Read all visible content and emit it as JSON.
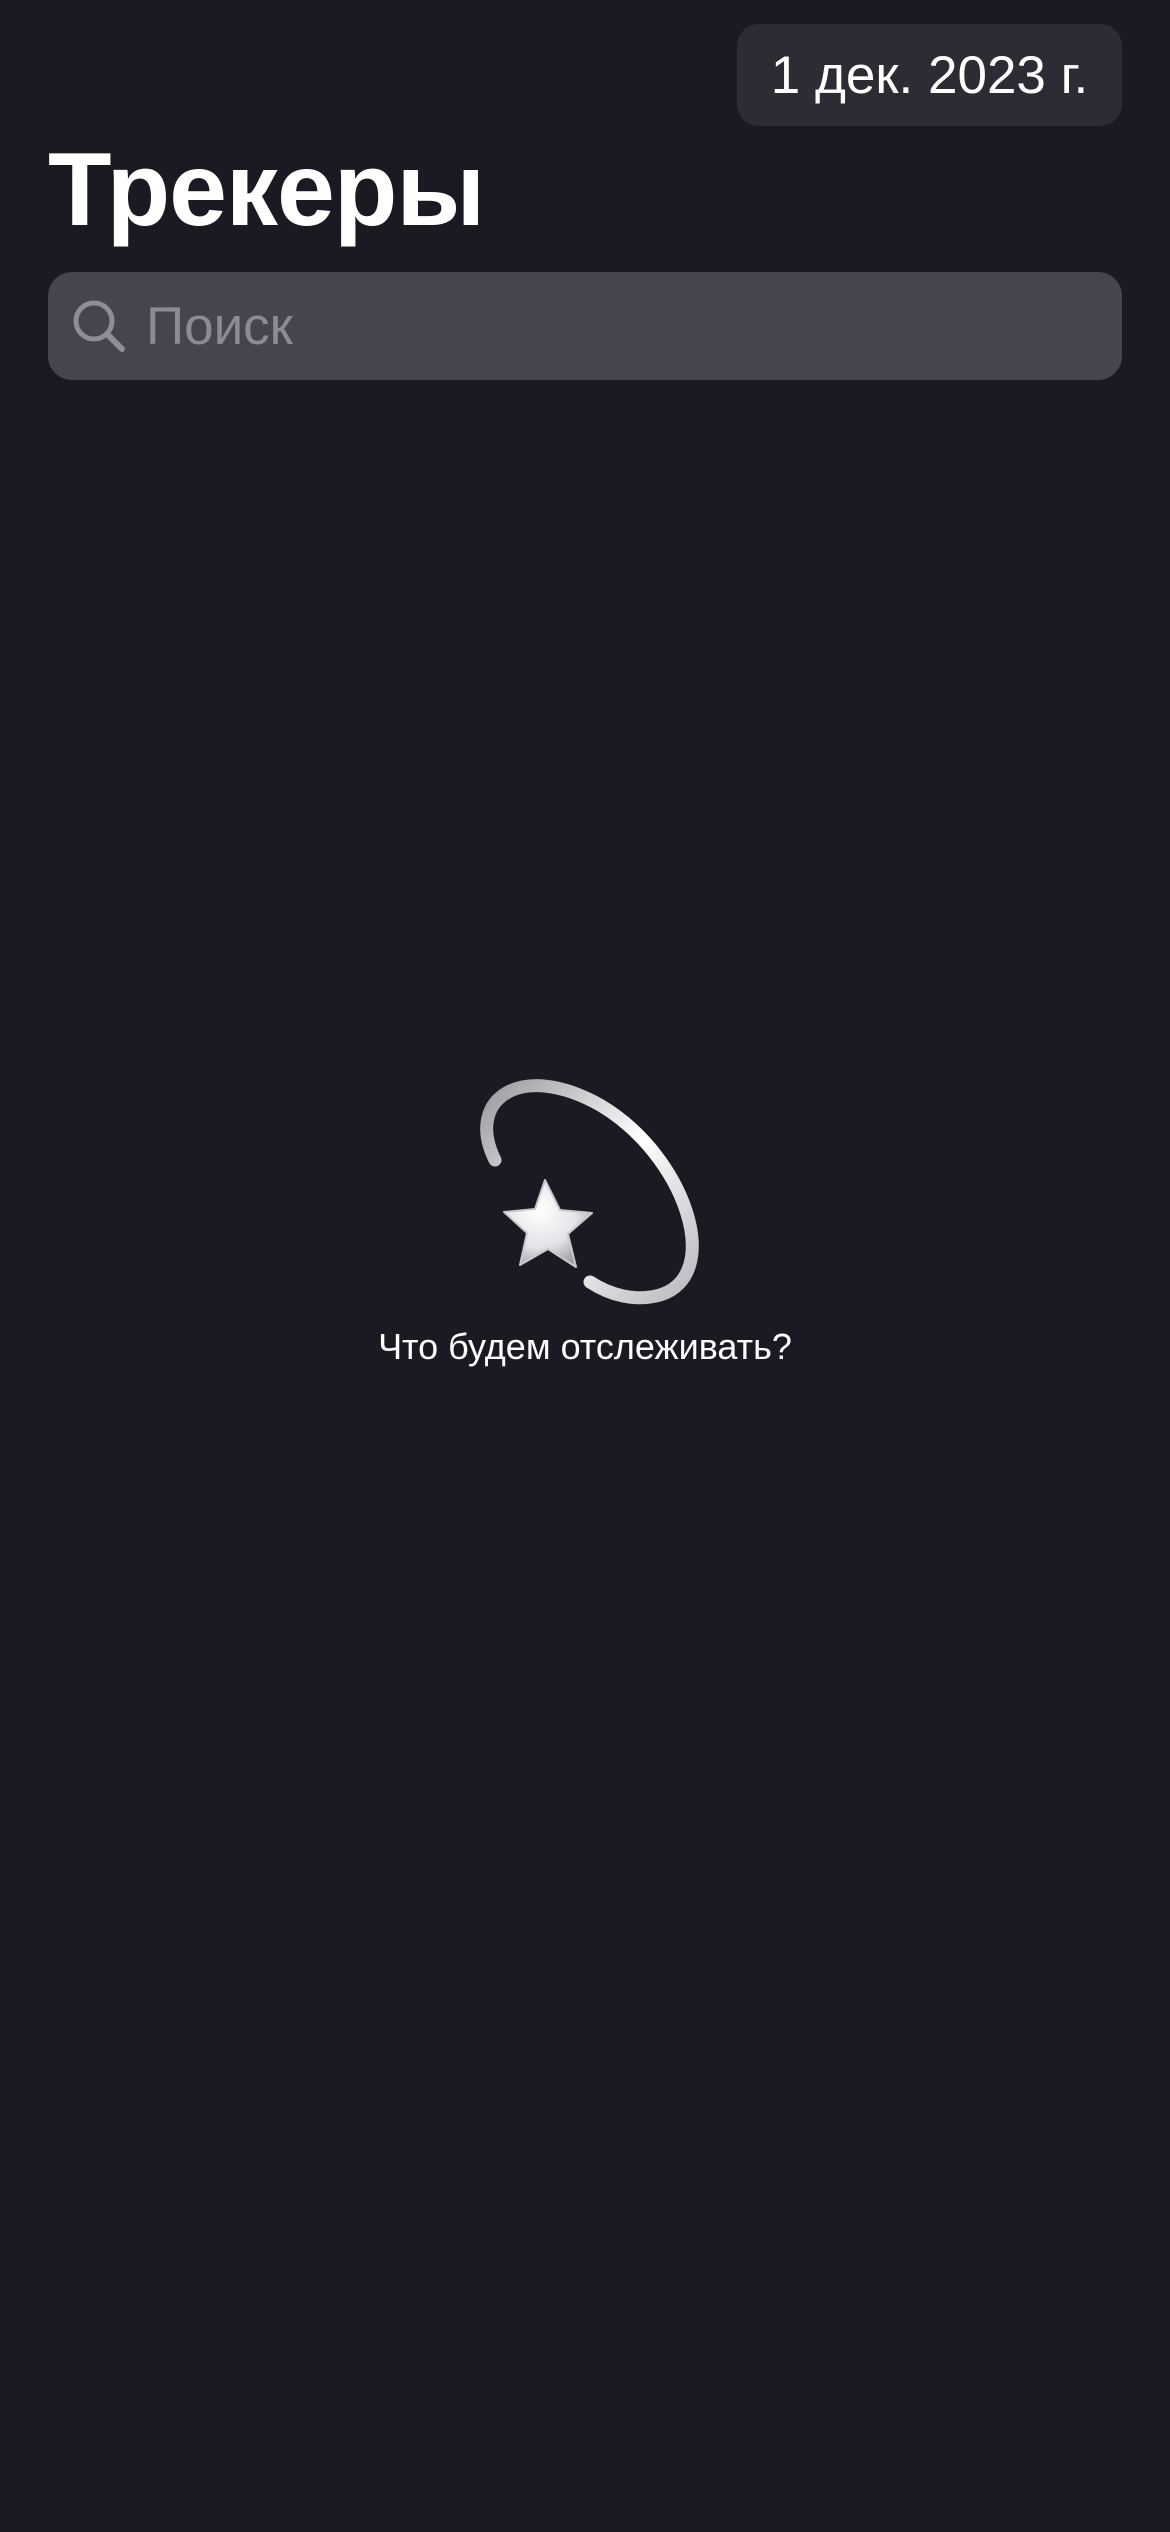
{
  "header": {
    "date_label": "1 дек. 2023 г.",
    "title": "Трекеры"
  },
  "search": {
    "placeholder": "Поиск",
    "value": "",
    "icon": "search-icon"
  },
  "empty_state": {
    "icon": "dizzy-star-icon",
    "text": "Что будем отслеживать?"
  },
  "colors": {
    "background": "#1a1b22",
    "date_button": "#2c2c34",
    "search_field": "#45454e",
    "placeholder": "#8b8b93",
    "text": "#ffffff"
  }
}
